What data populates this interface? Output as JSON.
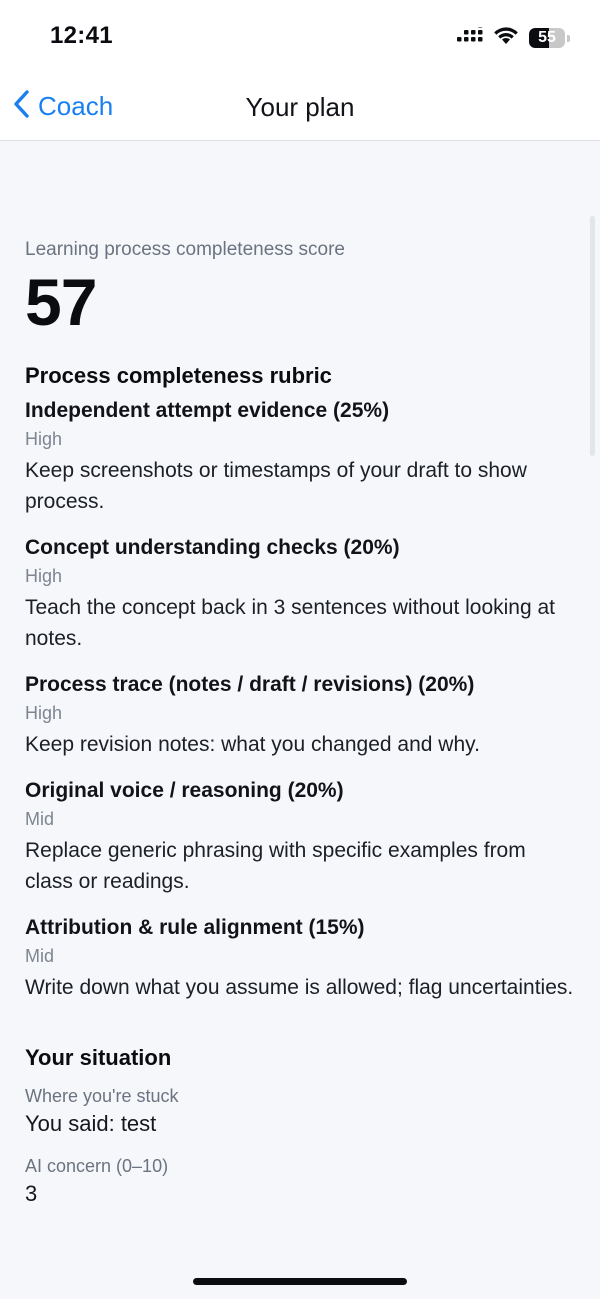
{
  "status_bar": {
    "time": "12:41",
    "battery_percent": "55",
    "battery_level": 0.55
  },
  "nav": {
    "back_label": "Coach",
    "title": "Your plan"
  },
  "score": {
    "caption": "Learning process completeness score",
    "value": "57"
  },
  "rubric": {
    "title": "Process completeness rubric",
    "items": [
      {
        "title": "Independent attempt evidence (25%)",
        "level": "High",
        "tip": "Keep screenshots or timestamps of your draft to show process."
      },
      {
        "title": "Concept understanding checks (20%)",
        "level": "High",
        "tip": "Teach the concept back in 3 sentences without looking at notes."
      },
      {
        "title": "Process trace (notes / draft / revisions) (20%)",
        "level": "High",
        "tip": "Keep revision notes: what you changed and why."
      },
      {
        "title": "Original voice / reasoning (20%)",
        "level": "Mid",
        "tip": "Replace generic phrasing with specific examples from class or readings."
      },
      {
        "title": "Attribution & rule alignment (15%)",
        "level": "Mid",
        "tip": "Write down what you assume is allowed; flag uncertainties."
      }
    ]
  },
  "situation": {
    "title": "Your situation",
    "stuck_label": "Where you're stuck",
    "stuck_value": "You said: test",
    "concern_label": "AI concern (0–10)",
    "concern_value": "3"
  },
  "colors": {
    "accent": "#1a7ff0",
    "background": "#f5f7fa",
    "muted_text": "#6c7380"
  }
}
